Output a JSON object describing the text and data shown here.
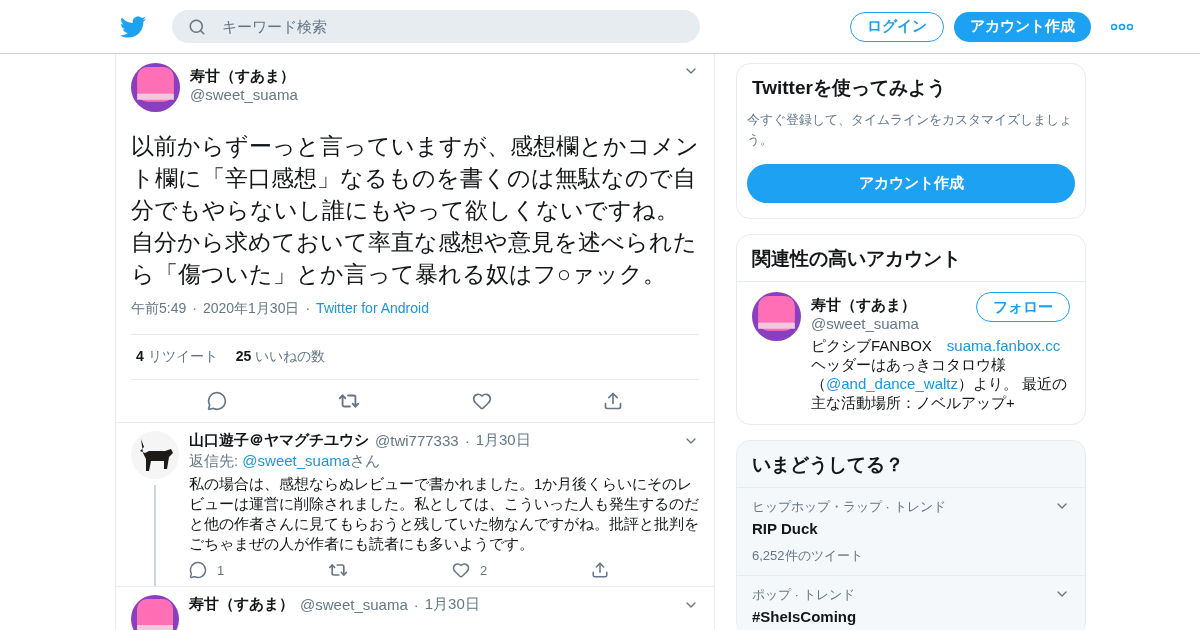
{
  "header": {
    "search_placeholder": "キーワード検索",
    "login": "ログイン",
    "signup": "アカウント作成"
  },
  "main_tweet": {
    "name": "寿甘（すあま）",
    "handle": "@sweet_suama",
    "avatar": {
      "kind": "pink"
    },
    "separator": "·",
    "text": "以前からずーっと言っていますが、感想欄とかコメント欄に「辛口感想」なるものを書くのは無駄なので自分でもやらないし誰にもやって欲しくないですね。自分から求めておいて率直な感想や意見を述べられたら「傷ついた」とか言って暴れる奴はフ○ァック。",
    "time": "午前5:49",
    "date": "2020年1月30日",
    "source": "Twitter for Android",
    "retweets": {
      "count": "4",
      "label": "リツイート"
    },
    "likes": {
      "count": "25",
      "label": "いいねの数"
    }
  },
  "replies": [
    {
      "name": "山口遊子＠ヤマグチユウシ",
      "handle": "@twi777333",
      "date": "1月30日",
      "avatar": {
        "kind": "dog"
      },
      "separator": "·",
      "thread": true,
      "reply_to": {
        "prefix": "返信先:",
        "handle": "@sweet_suama",
        "suffix": "さん"
      },
      "text": "私の場合は、感想ならぬレビューで書かれました。1か月後くらいにそのレビューは運営に削除されました。私としては、こういった人も発生するのだと他の作者さんに見てもらおうと残していた物なんですがね。批評と批判をごちゃまぜの人が作者にも読者にも多いようです。",
      "reply_count": "1",
      "like_count": "2"
    },
    {
      "name": "寿甘（すあま）",
      "handle": "@sweet_suama",
      "date": "1月30日",
      "avatar": {
        "kind": "pink"
      },
      "separator": "·",
      "thread": false
    }
  ],
  "signup_card": {
    "title": "Twitterを使ってみよう",
    "text": "今すぐ登録して、タイムラインをカスタマイズしましょう。",
    "button": "アカウント作成"
  },
  "related": {
    "title": "関連性の高いアカウント",
    "account": {
      "name": "寿甘（すあま）",
      "handle": "@sweet_suama",
      "avatar": {
        "kind": "pink"
      },
      "follow": "フォロー",
      "bio_prefix": "ピクシブFANBOX　",
      "bio_link": "suama.fanbox.cc",
      "bio_line2": "ヘッダーはあっきコタロウ様",
      "bio_open": "（",
      "bio_mention": "@and_dance_waltz",
      "bio_rest": "）より。 最近の主な活動場所：ノベルアップ+"
    }
  },
  "trends": {
    "title": "いまどうしてる？",
    "items": [
      {
        "category": "ヒップホップ・ラップ · トレンド",
        "name": "RIP Duck",
        "count": "6,252件のツイート"
      },
      {
        "category": "ポップ · トレンド",
        "name": "#SheIsComing"
      }
    ]
  }
}
